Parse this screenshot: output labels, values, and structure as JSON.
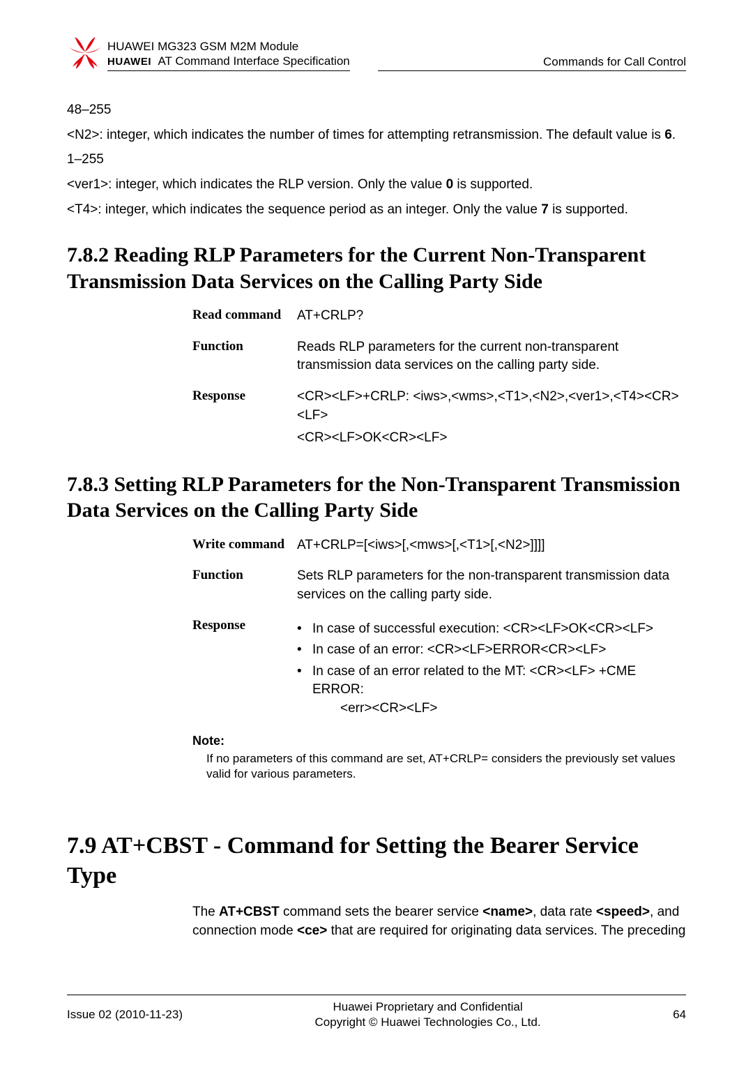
{
  "header": {
    "brand": "HUAWEI",
    "line1": "HUAWEI MG323 GSM M2M Module",
    "line2": "AT Command Interface Specification",
    "right": "Commands for Call Control"
  },
  "top": {
    "range1": "48–255",
    "n2_desc_a": "<N2>: integer, which indicates the number of times for attempting retransmission. The default value is ",
    "n2_desc_b": "6",
    "n2_desc_c": ".",
    "range2": "1–255",
    "ver1_a": "<ver1>: integer, which indicates the RLP version. Only the value ",
    "ver1_b": "0",
    "ver1_c": " is supported.",
    "t4_a": "<T4>: integer, which indicates the sequence period as an integer. Only the value ",
    "t4_b": "7",
    "t4_c": " is supported."
  },
  "s782": {
    "title": "7.8.2 Reading RLP Parameters for the Current Non-Transparent Transmission Data Services on the Calling Party Side",
    "read_label": "Read command",
    "read_cmd": "AT+CRLP?",
    "func_label": "Function",
    "func_text": "Reads RLP parameters for the current non-transparent transmission data services on the calling party side.",
    "resp_label": "Response",
    "resp_l1": "<CR><LF>+CRLP: <iws>,<wms>,<T1>,<N2>,<ver1>,<T4><CR><LF>",
    "resp_l2": "<CR><LF>OK<CR><LF>"
  },
  "s783": {
    "title": "7.8.3 Setting RLP Parameters for the Non-Transparent Transmission Data Services on the Calling Party Side",
    "write_label": "Write command",
    "write_cmd": "AT+CRLP=[<iws>[,<mws>[,<T1>[,<N2>]]]]",
    "func_label": "Function",
    "func_text": "Sets RLP parameters for the non-transparent transmission data services on the calling party side.",
    "resp_label": "Response",
    "b1": "In case of successful execution: <CR><LF>OK<CR><LF>",
    "b2": "In case of an error: <CR><LF>ERROR<CR><LF>",
    "b3a": "In case of an error related to the MT: <CR><LF> +CME ERROR:",
    "b3b": "<err><CR><LF>",
    "note_h": "Note:",
    "note_p": "If no parameters of this command are set, AT+CRLP= considers the previously set values valid for various parameters."
  },
  "s79": {
    "title": "7.9 AT+CBST - Command for Setting the Bearer Service Type",
    "intro_a": "The ",
    "intro_b": "AT+CBST",
    "intro_c": " command sets the bearer service ",
    "intro_d": "<name>",
    "intro_e": ", data rate ",
    "intro_f": "<speed>",
    "intro_g": ", and connection mode ",
    "intro_h": "<ce>",
    "intro_i": " that are required for originating data services. The preceding"
  },
  "footer": {
    "left": "Issue 02 (2010-11-23)",
    "c1": "Huawei Proprietary and Confidential",
    "c2": "Copyright © Huawei Technologies Co., Ltd.",
    "right": "64"
  }
}
